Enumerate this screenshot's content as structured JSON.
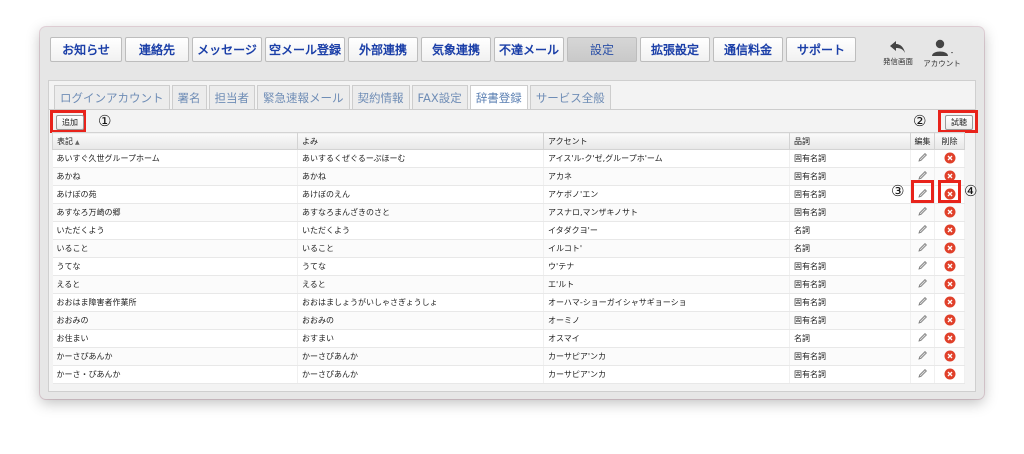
{
  "nav": {
    "items": [
      {
        "label": "お知らせ",
        "width": 72
      },
      {
        "label": "連絡先",
        "width": 64
      },
      {
        "label": "メッセージ",
        "width": 70
      },
      {
        "label": "空メール登録",
        "width": 80
      },
      {
        "label": "外部連携",
        "width": 70
      },
      {
        "label": "気象連携",
        "width": 70
      },
      {
        "label": "不達メール",
        "width": 70
      },
      {
        "label": "設定",
        "width": 70,
        "active": true
      },
      {
        "label": "拡張設定",
        "width": 70
      },
      {
        "label": "通信料金",
        "width": 70
      },
      {
        "label": "サポート",
        "width": 70
      }
    ],
    "send_screen_label": "発信画面",
    "account_label": "アカウント"
  },
  "tabs": [
    {
      "label": "ログインアカウント"
    },
    {
      "label": "署名"
    },
    {
      "label": "担当者"
    },
    {
      "label": "緊急速報メール"
    },
    {
      "label": "契約情報"
    },
    {
      "label": "FAX設定"
    },
    {
      "label": "辞書登録",
      "active": true
    },
    {
      "label": "サービス全般"
    }
  ],
  "toolbar": {
    "add_label": "追加",
    "test_label": "試聴",
    "marker_1": "①",
    "marker_2": "②",
    "marker_3": "③",
    "marker_4": "④"
  },
  "table": {
    "columns": {
      "notation": "表記",
      "reading": "よみ",
      "accent": "アクセント",
      "pos": "品詞",
      "edit": "編集",
      "delete": "削除"
    },
    "rows": [
      {
        "notation": "あいすぐ久世グループホーム",
        "reading": "あいするくぜぐるーぷほーむ",
        "accent": "アイス'ル-ク'ゼ,グループホ'ーム",
        "pos": "固有名詞"
      },
      {
        "notation": "あかね",
        "reading": "あかね",
        "accent": "アカネ",
        "pos": "固有名詞"
      },
      {
        "notation": "あけぼの苑",
        "reading": "あけぼのえん",
        "accent": "アケボノ'エン",
        "pos": "固有名詞"
      },
      {
        "notation": "あすなろ万崎の郷",
        "reading": "あすなろまんざきのさと",
        "accent": "アスナロ,マンザキノサト",
        "pos": "固有名詞"
      },
      {
        "notation": "いただくよう",
        "reading": "いただくよう",
        "accent": "イタダクヨ'ー",
        "pos": "名詞"
      },
      {
        "notation": "いること",
        "reading": "いること",
        "accent": "イルコト'",
        "pos": "名詞"
      },
      {
        "notation": "うてな",
        "reading": "うてな",
        "accent": "ウ'テナ",
        "pos": "固有名詞"
      },
      {
        "notation": "えると",
        "reading": "えると",
        "accent": "エ'ルト",
        "pos": "固有名詞"
      },
      {
        "notation": "おおはま障害者作業所",
        "reading": "おおはましょうがいしゃさぎょうしょ",
        "accent": "オーハマ-ショーガイシャサギョーショ",
        "pos": "固有名詞"
      },
      {
        "notation": "おおみの",
        "reading": "おおみの",
        "accent": "オーミノ",
        "pos": "固有名詞"
      },
      {
        "notation": "お住まい",
        "reading": "おすまい",
        "accent": "オスマイ",
        "pos": "名詞"
      },
      {
        "notation": "かーさぴあんか",
        "reading": "かーさぴあんか",
        "accent": "カーサピア'ンカ",
        "pos": "固有名詞"
      },
      {
        "notation": "かーさ・ぴあんか",
        "reading": "かーさぴあんか",
        "accent": "カーサピア'ンカ",
        "pos": "固有名詞"
      }
    ]
  },
  "colors": {
    "highlight": "#e8231b",
    "link": "#1b3fa8",
    "delete": "#e0402a"
  }
}
